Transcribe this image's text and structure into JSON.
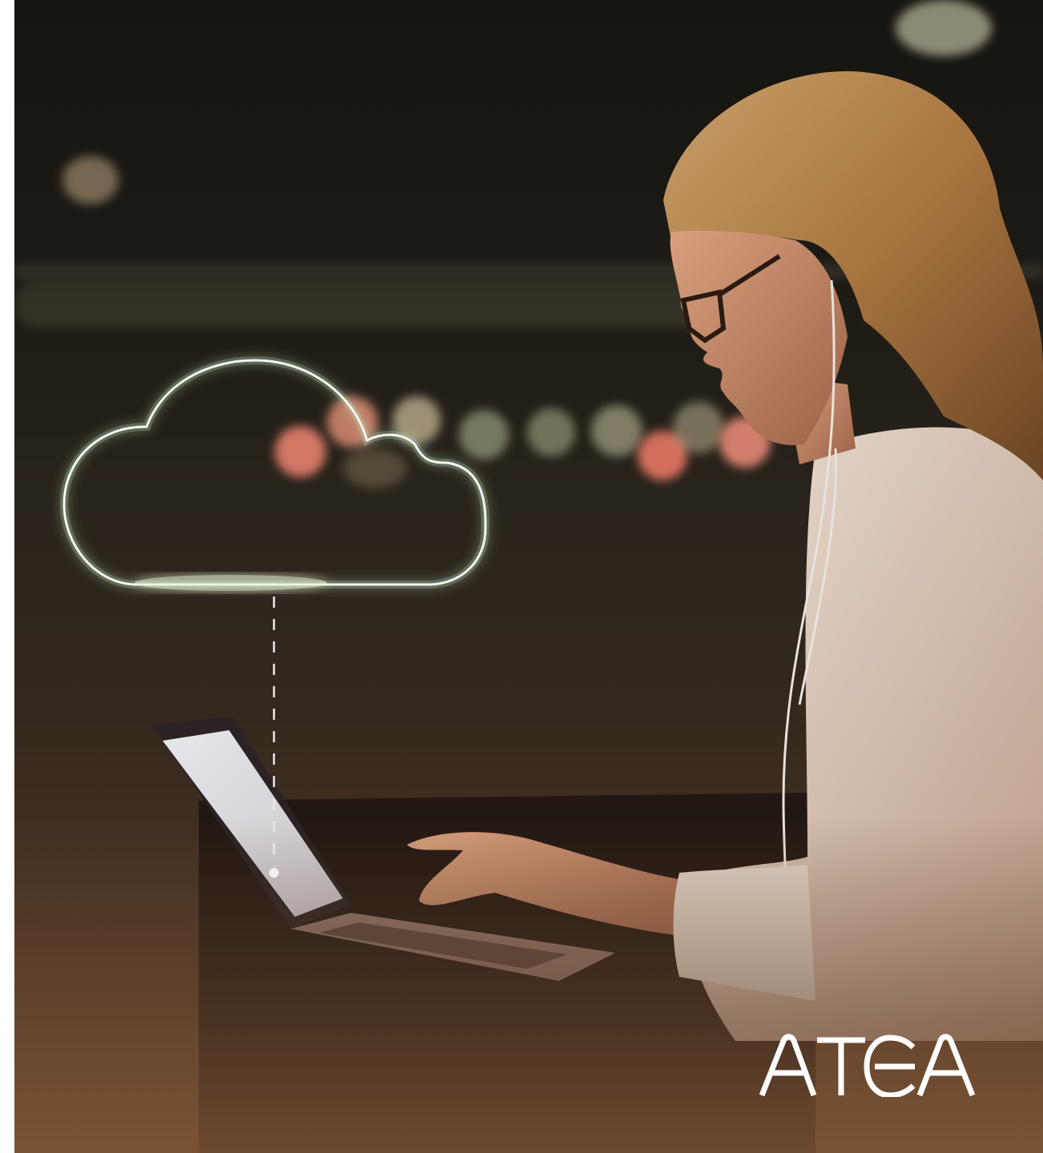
{
  "brand": {
    "logo_text": "ATEA",
    "logo_color": "#ffffff"
  },
  "scene": {
    "description_icon": "cloud-icon",
    "accent_glow": "#7fd98a",
    "skin": "#c98c6a",
    "hair": "#b88a50",
    "shirt": "#e8dcd2"
  }
}
